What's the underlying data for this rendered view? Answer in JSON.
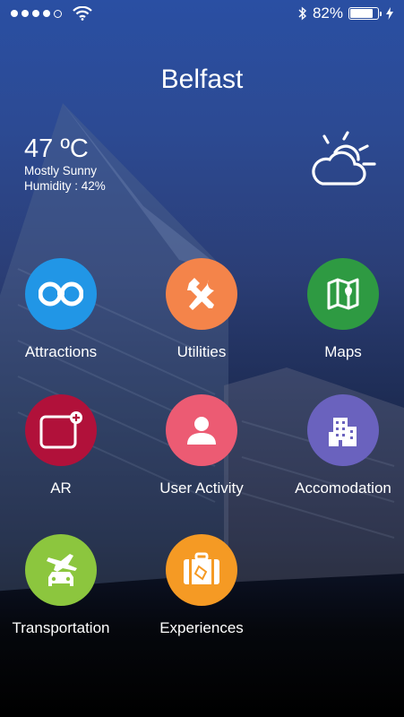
{
  "status_bar": {
    "battery_percent": "82%",
    "icons": [
      "signal-dots",
      "wifi-icon",
      "bluetooth-icon",
      "battery-icon",
      "charging-icon"
    ]
  },
  "city": "Belfast",
  "weather": {
    "temperature": "47 ºC",
    "condition": "Mostly Sunny",
    "humidity": "Humidity : 42%",
    "icon": "partly-sunny-icon"
  },
  "grid": [
    {
      "label": "Attractions",
      "color": "#2196e6",
      "icon": "binoculars-icon"
    },
    {
      "label": "Utilities",
      "color": "#f4844a",
      "icon": "tools-icon"
    },
    {
      "label": "Maps",
      "color": "#2e9a42",
      "icon": "map-icon"
    },
    {
      "label": "AR",
      "color": "#b1113a",
      "icon": "ar-icon"
    },
    {
      "label": "User Activity",
      "color": "#ec5b73",
      "icon": "user-icon"
    },
    {
      "label": "Accomodation",
      "color": "#6a62be",
      "icon": "building-icon"
    },
    {
      "label": "Transportation",
      "color": "#8cc63e",
      "icon": "transport-icon"
    },
    {
      "label": "Experiences",
      "color": "#f59a24",
      "icon": "suitcase-icon"
    }
  ]
}
